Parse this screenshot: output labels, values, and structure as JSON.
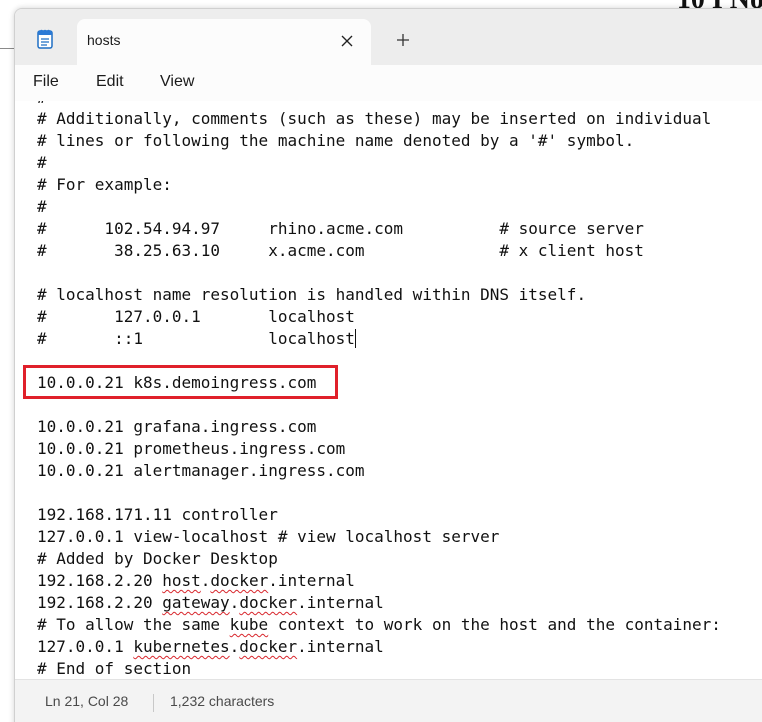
{
  "background": {
    "partial_text": "10 I No"
  },
  "tab": {
    "title": "hosts",
    "close_icon": "close-icon",
    "new_tab_icon": "plus-icon"
  },
  "menu": {
    "file": "File",
    "edit": "Edit",
    "view": "View"
  },
  "editor": {
    "lines": [
      "#",
      "# Additionally, comments (such as these) may be inserted on individual",
      "# lines or following the machine name denoted by a '#' symbol.",
      "#",
      "# For example:",
      "#",
      "#      102.54.94.97     rhino.acme.com          # source server",
      "#       38.25.63.10     x.acme.com              # x client host",
      "",
      "# localhost name resolution is handled within DNS itself.",
      "#       127.0.0.1       localhost",
      "#       ::1             localhost",
      "",
      "10.0.0.21 k8s.demoingress.com",
      "",
      "10.0.0.21 grafana.ingress.com",
      "10.0.0.21 prometheus.ingress.com",
      "10.0.0.21 alertmanager.ingress.com",
      "",
      "192.168.171.11 controller",
      "127.0.0.1 view-localhost # view localhost server",
      "# Added by Docker Desktop",
      "192.168.2.20 host.docker.internal",
      "192.168.2.20 gateway.docker.internal",
      "# To allow the same kube context to work on the host and the container:",
      "127.0.0.1 kubernetes.docker.internal",
      "# End of section"
    ],
    "spellcheck_words": [
      "host",
      "docker",
      "gateway",
      "docker",
      "kube",
      "kubernetes",
      "docker"
    ]
  },
  "status": {
    "position": "Ln 21, Col 28",
    "characters": "1,232 characters"
  },
  "colors": {
    "highlight": "#e0202a",
    "spellcheck": "#d8262c"
  }
}
